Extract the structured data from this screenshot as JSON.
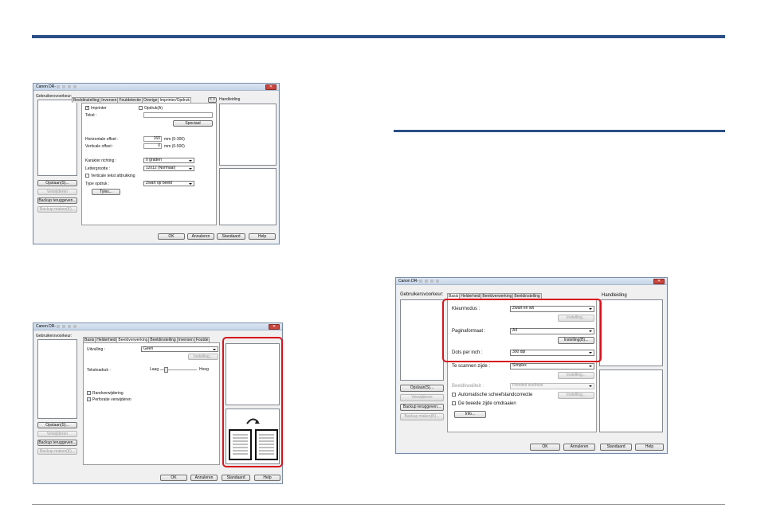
{
  "dialog1": {
    "title": "Canon DR-",
    "close_symbol": "✕",
    "prefs_label": "Gebruikersvoorkeur:",
    "tabs": [
      "Beeldinstelling",
      "Inversen",
      "Foutdetectie",
      "Overige",
      "Imprinter/Opdruk"
    ],
    "tab_scroll": "< >",
    "manual_label": "Handleiding",
    "imprinter_label": "Imprinter",
    "opdruk_label": "Opdruk(A)",
    "tekst_label": "Tekst :",
    "speciaal_button": "Speciaal",
    "h_offset_label": "Horizontale offset :",
    "h_offset_value": "160",
    "h_offset_unit": "mm (0-300)",
    "v_offset_label": "Verticale offset :",
    "v_offset_value": "0",
    "v_offset_unit": "mm (0-500)",
    "char_dir_label": "Karakter richting :",
    "char_dir_value": "0 graden",
    "fontsize_label": "Lettergrootte :",
    "fontsize_value": "12x12 (Normaal)",
    "vertical_print_label": "Verticale tekst afdrukking",
    "type_label": "Type opdruk :",
    "type_value": "Zwart op beeld",
    "styles_button": "Tyles...",
    "opslaan": "Opslaan(S)...",
    "verwijderen": "Verwijderen",
    "backup_terug": "Backup teruggeven...",
    "backup_maken": "Backup maken(K)...",
    "ok": "OK",
    "annuleren": "Annuleren",
    "standaard": "Standaard",
    "help": "Help"
  },
  "dialog2": {
    "title": "Canon DR-",
    "close_symbol": "✕",
    "prefs_label": "Gebruikersvoorkeur:",
    "tabs": [
      "Basis",
      "Helderheid",
      "Beeldverwerking",
      "Beeldinstelling",
      "Inversen",
      "Foutde"
    ],
    "uitvulling_label": "Uitvulling :",
    "uitvulling_value": "Geen",
    "instelling_button": "Instelling...",
    "sharpness_label": "Tekstnadruk :",
    "sharp_low": "Laag",
    "sharp_high": "Hoog",
    "sharpness_value": 0.15,
    "randverwijdering": "Randverwijdering",
    "perforatie": "Perforatie verwijderen",
    "opslaan": "Opslaan(S)...",
    "verwijderen": "Verwijderen",
    "backup_terug": "Backup teruggeven...",
    "backup_maken": "Backup maken(K)...",
    "ok": "OK",
    "annuleren": "Annuleren",
    "standaard": "Standaard",
    "help": "Help"
  },
  "dialog3": {
    "title": "Canon DR-",
    "close_symbol": "✕",
    "prefs_label": "Gebruikersvoorkeur:",
    "tabs": [
      "Basis",
      "Helderheid",
      "Beeldverwerking",
      "Beeldinstelling",
      "Inversen",
      "Foutdetectie"
    ],
    "manual_label": "Handleiding",
    "kleurmodus_label": "Kleurmodus :",
    "kleurmodus_value": "Zwart en wit",
    "instelling_dis": "Instelling...",
    "paginaformaat_label": "Paginaformaat :",
    "paginaformaat_value": "A4",
    "instelling_b": "Instelling(B)...",
    "dpi_label": "Dots per inch :",
    "dpi_value": "300 dpi",
    "scanzijde_label": "Te scannen zijde :",
    "scanzijde_value": "Simplex",
    "instelling2": "Instelling...",
    "beeldkwaliteit_label": "Beeldkwaliteit :",
    "beeldkwaliteit_value": "Prioriteit snelheid",
    "auto_skew": "Automatische scheefstandcorrectie",
    "instelling3": "Instelling...",
    "rotate_second": "De tweede zijde omdraaien",
    "info_button": "Info...",
    "opslaan": "Opslaan(S)...",
    "verwijderen": "Verwijderen",
    "backup_terug": "Backup teruggeven...",
    "backup_maken": "Backup maken(K)...",
    "ok": "OK",
    "annuleren": "Annuleren",
    "standaard": "Standaard",
    "help": "Help"
  },
  "colors": {
    "accent_rule": "#2b4f86",
    "highlight": "#d7141d",
    "close_button": "#c9463d"
  }
}
